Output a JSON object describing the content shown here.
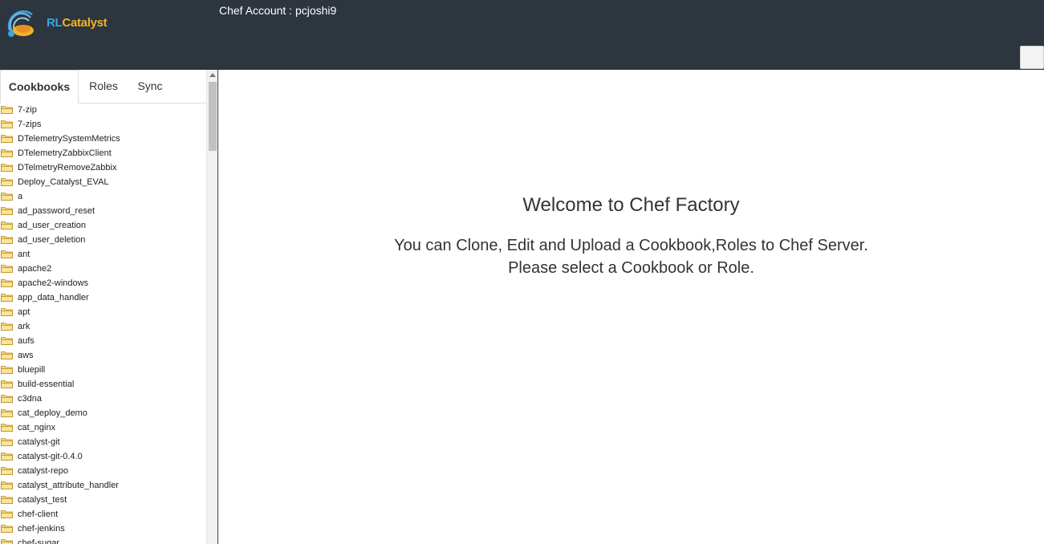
{
  "brand": {
    "logo_rl": "RL",
    "logo_catalyst": "Catalyst"
  },
  "header": {
    "account_text": "Chef Account : pcjoshi9"
  },
  "tabs": [
    {
      "label": "Cookbooks",
      "active": true
    },
    {
      "label": "Roles",
      "active": false
    },
    {
      "label": "Sync",
      "active": false
    }
  ],
  "cookbooks": [
    "7-zip",
    "7-zips",
    "DTelemetrySystemMetrics",
    "DTelemetryZabbixClient",
    "DTelmetryRemoveZabbix",
    "Deploy_Catalyst_EVAL",
    "a",
    "ad_password_reset",
    "ad_user_creation",
    "ad_user_deletion",
    "ant",
    "apache2",
    "apache2-windows",
    "app_data_handler",
    "apt",
    "ark",
    "aufs",
    "aws",
    "bluepill",
    "build-essential",
    "c3dna",
    "cat_deploy_demo",
    "cat_nginx",
    "catalyst-git",
    "catalyst-git-0.4.0",
    "catalyst-repo",
    "catalyst_attribute_handler",
    "catalyst_test",
    "chef-client",
    "chef-jenkins",
    "chef-sugar"
  ],
  "icons": {
    "tree_item": "folder-icon",
    "logo": "rlcatalyst-logo-icon"
  },
  "colors": {
    "header_bg": "#2d353e",
    "folder": "#f2c94c"
  },
  "main": {
    "welcome_title": "Welcome to Chef Factory",
    "description_line1": "You can Clone, Edit and Upload a Cookbook,Roles to Chef Server.",
    "description_line2": "Please select a Cookbook or Role."
  }
}
